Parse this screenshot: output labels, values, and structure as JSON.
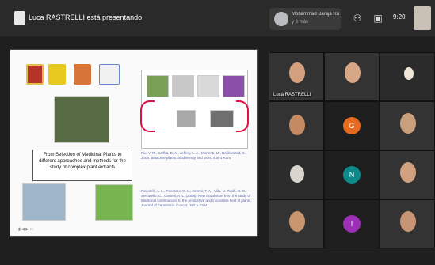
{
  "topbar": {
    "presenting_text": "Luca RASTRELLI está presentando",
    "participant_name": "Mohammad Baraja Roo...",
    "participant_sub": "y 3 más",
    "clock": "9:20",
    "icons": [
      "people-icon",
      "chat-icon"
    ]
  },
  "slide": {
    "title_box": "From Selection of Medicinal Plants to different approaches and methods for the study of complex plant extracts",
    "ref_top": "Piu, V. R., Sarfka, D. A., Jeffrey, L. A., Menenti, M., Rafikwazed, S., 2005. Bioactive plants: biodiversity and uses. 438-1 Kars.",
    "ref_bottom": "Piccolelli, A. L., Pecoraro, G. L., Grenni, T. A., Villa, N. Pirolli, D. G., Serrarello, C., Castelli, A. L. (2008). New acquisition from the study of Medicinal contributions to the productive and innovative field of plants. Journal of Fannisticio d'uno 4, 197 e 3104.",
    "footer": "▮ ◀ ▶ ▭"
  },
  "participants": [
    {
      "name": "Luca RASTRELLI",
      "initial": "",
      "color": "#6a5f52"
    },
    {
      "name": "",
      "initial": "",
      "color": "#5a524c"
    },
    {
      "name": "",
      "initial": "",
      "color": "#2b2b2b"
    },
    {
      "name": "",
      "initial": "",
      "color": "#6b5f50"
    },
    {
      "name": "",
      "initial": "G",
      "color": "#e66a1f"
    },
    {
      "name": "",
      "initial": "",
      "color": "#8c7b66"
    },
    {
      "name": "",
      "initial": "",
      "color": "#2c2c2c"
    },
    {
      "name": "",
      "initial": "N",
      "color": "#0c8a8a"
    },
    {
      "name": "",
      "initial": "",
      "color": "#7a5f4c"
    },
    {
      "name": "",
      "initial": "",
      "color": "#7d7464"
    },
    {
      "name": "",
      "initial": "I",
      "color": "#9b2fb6"
    },
    {
      "name": "",
      "initial": "",
      "color": "#7f6a58"
    }
  ]
}
